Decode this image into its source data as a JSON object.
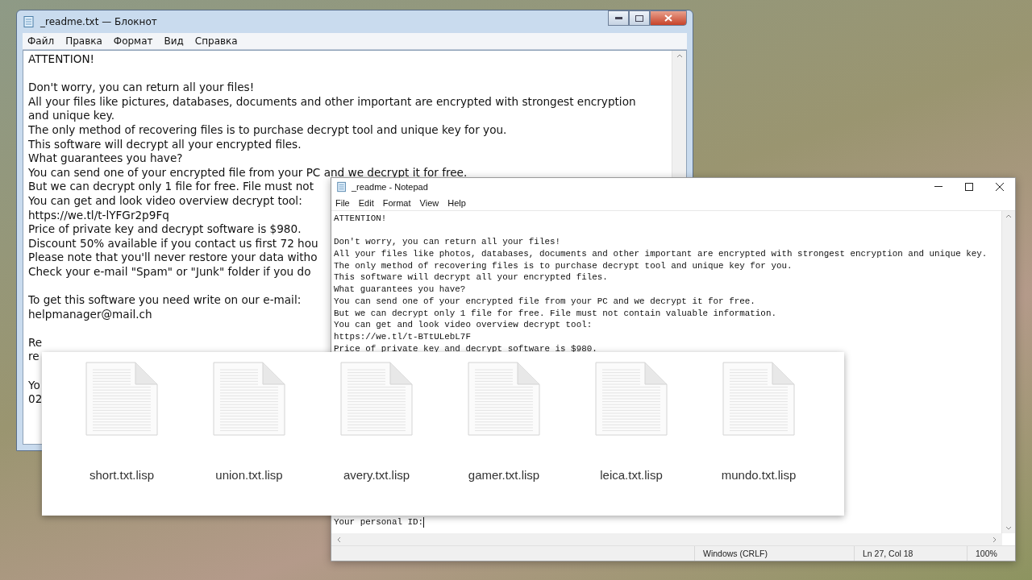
{
  "windows": [
    {
      "kind": "classic",
      "title": "_readme.txt — Блокнот",
      "menu": [
        "Файл",
        "Правка",
        "Формат",
        "Вид",
        "Справка"
      ],
      "paragraphs": [
        [
          "ATTENTION!"
        ],
        [
          "Don't worry, you can return all your files!",
          "All your files like pictures, databases, documents and other important are encrypted with strongest encryption",
          "and unique key.",
          "The only method of recovering files is to purchase decrypt tool and unique key for you.",
          "This software will decrypt all your encrypted files.",
          "What guarantees you have?",
          "You can send one of your encrypted file from your PC and we decrypt it for free.",
          "But we can decrypt only 1 file for free. File must not",
          "You can get and look video overview decrypt tool:",
          "https://we.tl/t-lYFGr2p9Fq",
          "Price of private key and decrypt software is $980.",
          "Discount 50% available if you contact us first 72 hou",
          "Please note that you'll never restore your data witho",
          "Check your e-mail \"Spam\" or \"Junk\" folder if you do"
        ],
        [
          "To get this software you need write on our e-mail:",
          "helpmanager@mail.ch"
        ],
        [
          "Re",
          "re"
        ],
        [
          "Yo",
          "02"
        ]
      ]
    },
    {
      "kind": "modern",
      "title": "_readme - Notepad",
      "menu": [
        "File",
        "Edit",
        "Format",
        "View",
        "Help"
      ],
      "paragraphs": [
        [
          "ATTENTION!"
        ],
        [
          "Don't worry, you can return all your files!",
          "All your files like photos, databases, documents and other important are encrypted with strongest encryption and unique key.",
          "The only method of recovering files is to purchase decrypt tool and unique key for you.",
          "This software will decrypt all your encrypted files.",
          "What guarantees you have?",
          "You can send one of your encrypted file from your PC and we decrypt it for free.",
          "But we can decrypt only 1 file for free. File must not contain valuable information.",
          "You can get and look video overview decrypt tool:",
          "https://we.tl/t-BTtULebL7F",
          "Price of private key and decrypt software is $980."
        ]
      ],
      "last_line": "Your personal ID:",
      "status_bar": [
        "Windows (CRLF)",
        "Ln 27, Col 18",
        "100%"
      ]
    }
  ],
  "file_panel": {
    "files": [
      "short.txt.lisp",
      "union.txt.lisp",
      "avery.txt.lisp",
      "gamer.txt.lisp",
      "leica.txt.lisp",
      "mundo.txt.lisp"
    ]
  }
}
